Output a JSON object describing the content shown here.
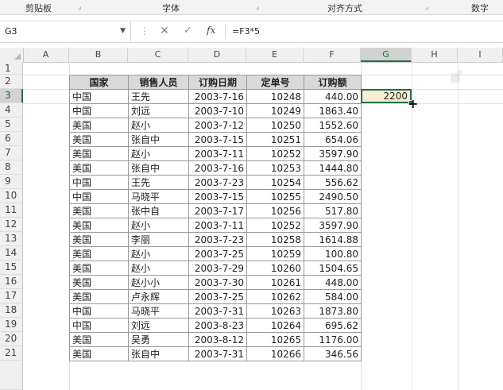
{
  "ribbon": {
    "groups": [
      "剪贴板",
      "字体",
      "对齐方式",
      "数字"
    ]
  },
  "formula_bar": {
    "name_box": "G3",
    "cancel_icon": "✕",
    "enter_icon": "✓",
    "fx_label": "fx",
    "formula": "=F3*5"
  },
  "columns": [
    "A",
    "B",
    "C",
    "D",
    "E",
    "F",
    "G",
    "H",
    "I"
  ],
  "rows": [
    "1",
    "2",
    "3",
    "4",
    "5",
    "6",
    "7",
    "8",
    "9",
    "10",
    "11",
    "12",
    "13",
    "14",
    "15",
    "16",
    "17",
    "18",
    "19",
    "20",
    "21"
  ],
  "selected": {
    "column": "G",
    "row": "3",
    "value": "2200"
  },
  "table": {
    "headers": [
      "国家",
      "销售人员",
      "订购日期",
      "定单号",
      "订购额"
    ],
    "rows": [
      [
        "中国",
        "王先",
        "2003-7-16",
        "10248",
        "440.00"
      ],
      [
        "中国",
        "刘远",
        "2003-7-10",
        "10249",
        "1863.40"
      ],
      [
        "美国",
        "赵小",
        "2003-7-12",
        "10250",
        "1552.60"
      ],
      [
        "美国",
        "张自中",
        "2003-7-15",
        "10251",
        "654.06"
      ],
      [
        "美国",
        "赵小",
        "2003-7-11",
        "10252",
        "3597.90"
      ],
      [
        "美国",
        "张自中",
        "2003-7-16",
        "10253",
        "1444.80"
      ],
      [
        "中国",
        "王先",
        "2003-7-23",
        "10254",
        "556.62"
      ],
      [
        "中国",
        "马晓平",
        "2003-7-15",
        "10255",
        "2490.50"
      ],
      [
        "美国",
        "张中自",
        "2003-7-17",
        "10256",
        "517.80"
      ],
      [
        "美国",
        "赵小",
        "2003-7-11",
        "10252",
        "3597.90"
      ],
      [
        "美国",
        "李丽",
        "2003-7-23",
        "10258",
        "1614.88"
      ],
      [
        "美国",
        "赵小",
        "2003-7-25",
        "10259",
        "100.80"
      ],
      [
        "美国",
        "赵小",
        "2003-7-29",
        "10260",
        "1504.65"
      ],
      [
        "美国",
        "赵小小",
        "2003-7-30",
        "10261",
        "448.00"
      ],
      [
        "美国",
        "卢永辉",
        "2003-7-25",
        "10262",
        "584.00"
      ],
      [
        "中国",
        "马晓平",
        "2003-7-31",
        "10263",
        "1873.80"
      ],
      [
        "中国",
        "刘远",
        "2003-8-23",
        "10264",
        "695.62"
      ],
      [
        "美国",
        "吴勇",
        "2003-8-12",
        "10265",
        "1176.00"
      ],
      [
        "美国",
        "张自中",
        "2003-7-31",
        "10266",
        "346.56"
      ]
    ]
  },
  "colors": {
    "accent": "#217346",
    "active_fill": "#f9eed3",
    "header_fill": "#d9d9d9"
  }
}
